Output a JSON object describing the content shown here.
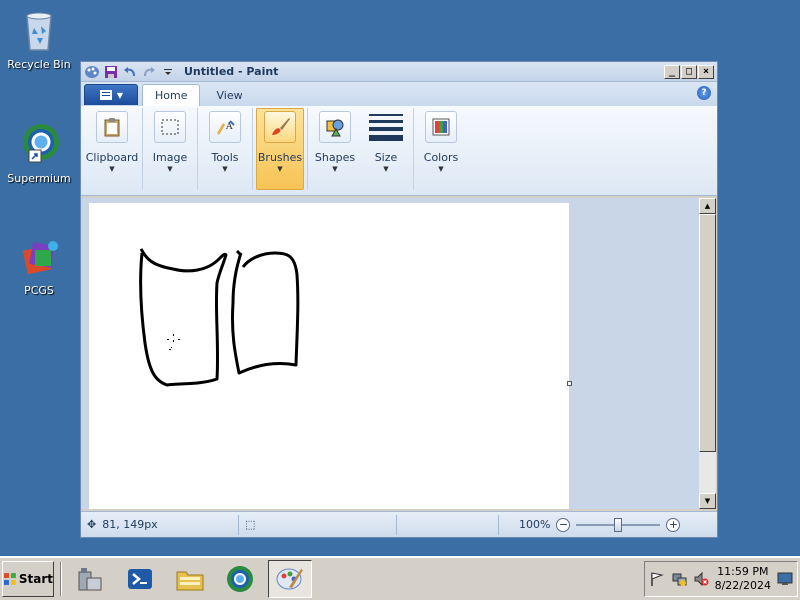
{
  "desktop": {
    "icons": [
      {
        "label": "Recycle Bin"
      },
      {
        "label": "Supermium"
      },
      {
        "label": "PCGS"
      }
    ]
  },
  "window": {
    "title": "Untitled - Paint",
    "tabs": [
      {
        "label": "Home",
        "active": true
      },
      {
        "label": "View",
        "active": false
      }
    ],
    "help_label": "?",
    "ribbon_groups": [
      {
        "label": "Clipboard",
        "icon": "clipboard-icon"
      },
      {
        "label": "Image",
        "icon": "select-icon"
      },
      {
        "label": "Tools",
        "icon": "tools-icon"
      },
      {
        "label": "Brushes",
        "icon": "brush-icon",
        "selected": true
      },
      {
        "label": "Shapes",
        "icon": "shapes-icon"
      },
      {
        "label": "Size",
        "icon": "size-icon"
      },
      {
        "label": "Colors",
        "icon": "palette-icon"
      }
    ]
  },
  "status": {
    "cursor_pos": "81, 149px",
    "zoom": "100%",
    "zoom_level": 1.0
  },
  "taskbar": {
    "start_label": "Start",
    "clock_time": "11:59 PM",
    "clock_date": "8/22/2024"
  },
  "colors": {
    "desktop": "#3a6ea5",
    "selected_group": "#f7c354"
  }
}
